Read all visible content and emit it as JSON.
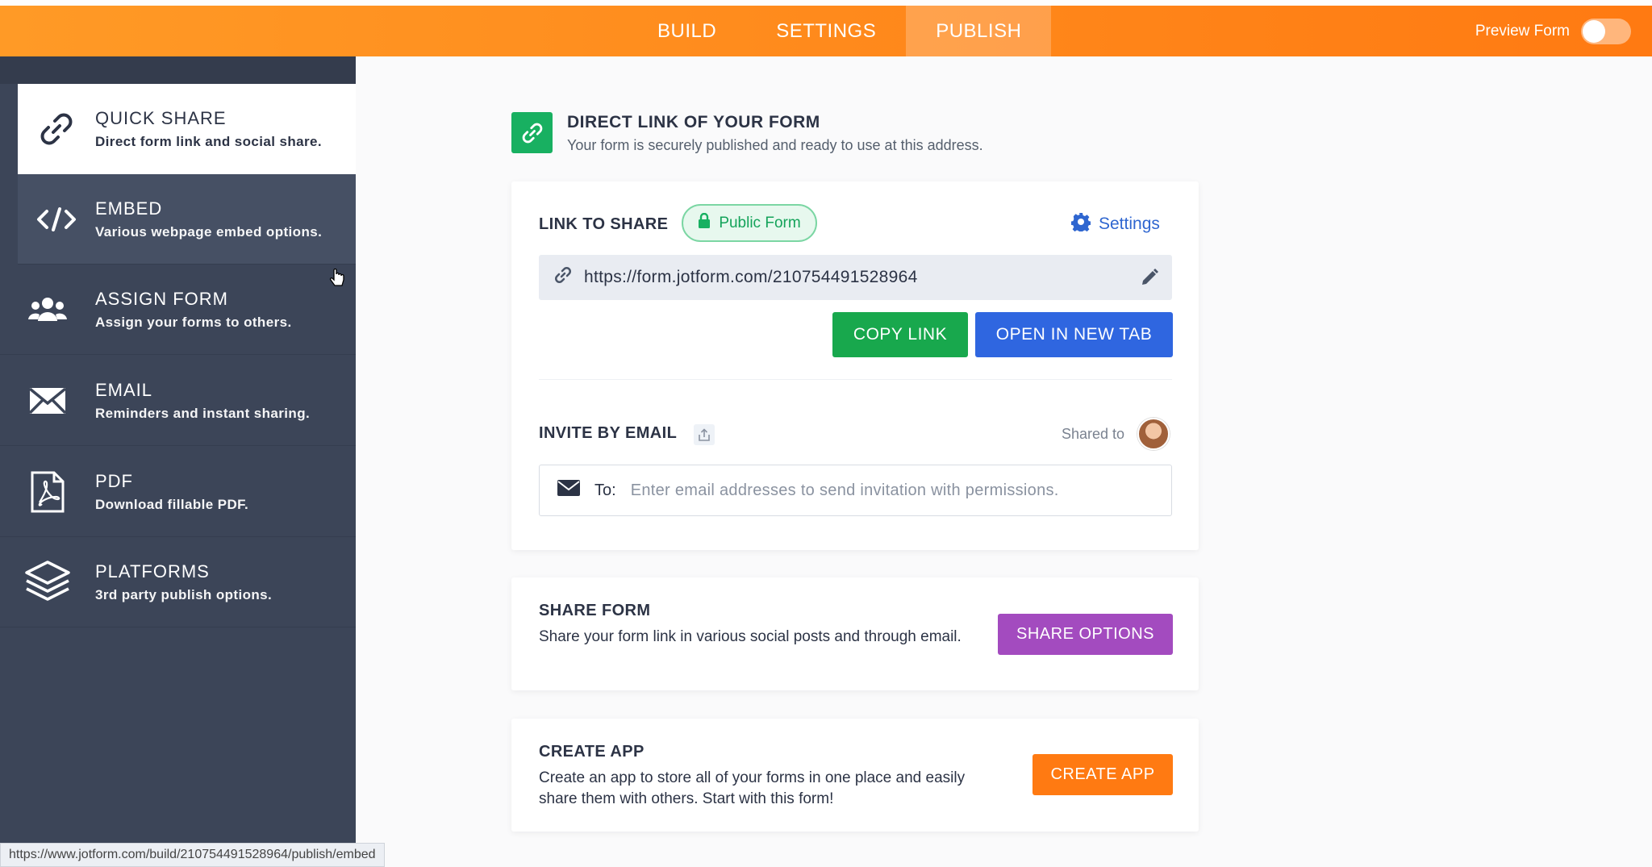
{
  "topbar": {
    "tabs": [
      {
        "label": "BUILD"
      },
      {
        "label": "SETTINGS"
      },
      {
        "label": "PUBLISH",
        "active": true
      }
    ],
    "preview_label": "Preview Form",
    "preview_on": false
  },
  "sidebar": {
    "items": [
      {
        "title": "QUICK SHARE",
        "desc": "Direct form link and social share.",
        "icon": "link-icon",
        "state": "active"
      },
      {
        "title": "EMBED",
        "desc": "Various webpage embed options.",
        "icon": "code-icon",
        "state": "hover"
      },
      {
        "title": "ASSIGN FORM",
        "desc": "Assign your forms to others.",
        "icon": "users-icon"
      },
      {
        "title": "EMAIL",
        "desc": "Reminders and instant sharing.",
        "icon": "envelope-icon"
      },
      {
        "title": "PDF",
        "desc": "Download fillable PDF.",
        "icon": "pdf-icon"
      },
      {
        "title": "PLATFORMS",
        "desc": "3rd party publish options.",
        "icon": "layers-icon"
      }
    ]
  },
  "header": {
    "title": "DIRECT LINK OF YOUR FORM",
    "subtitle": "Your form is securely published and ready to use at this address."
  },
  "link_card": {
    "label": "LINK TO SHARE",
    "badge": "Public Form",
    "settings_label": "Settings",
    "url": "https://form.jotform.com/210754491528964",
    "copy_label": "COPY LINK",
    "open_label": "OPEN IN NEW TAB",
    "invite_label": "INVITE BY EMAIL",
    "shared_to_label": "Shared to",
    "to_label": "To:",
    "email_placeholder": "Enter email addresses to send invitation with permissions."
  },
  "share_card": {
    "title": "SHARE FORM",
    "desc": "Share your form link in various social posts and through email.",
    "button": "SHARE OPTIONS"
  },
  "app_card": {
    "title": "CREATE APP",
    "desc": "Create an app to store all of your forms in one place and easily share them with others. Start with this form!",
    "button": "CREATE APP"
  },
  "status_url": "https://www.jotform.com/build/210754491528964/publish/embed",
  "colors": {
    "topbar": "#ff8a1c",
    "sidebar": "#3c4558",
    "green": "#18a84d",
    "blue": "#2f66e0",
    "purple": "#a34bbf",
    "orange": "#ff7a12"
  }
}
